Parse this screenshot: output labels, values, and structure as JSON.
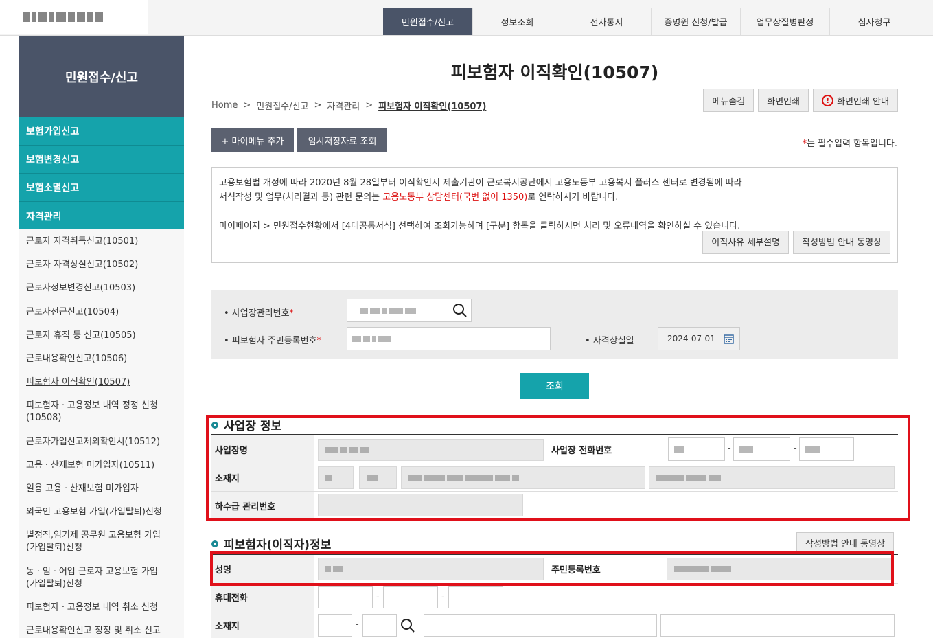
{
  "nav": {
    "items": [
      "민원접수/신고",
      "정보조회",
      "전자통지",
      "증명원 신청/발급",
      "업무상질병판정",
      "심사청구"
    ],
    "active_index": 0
  },
  "sidebar": {
    "title": "민원접수/신고",
    "main_items": [
      "보험가입신고",
      "보험변경신고",
      "보험소멸신고",
      "자격관리"
    ],
    "sub_items": [
      "근로자 자격취득신고(10501)",
      "근로자 자격상실신고(10502)",
      "근로자정보변경신고(10503)",
      "근로자전근신고(10504)",
      "근로자 휴직 등 신고(10505)",
      "근로내용확인신고(10506)",
      "피보험자 이직확인(10507)",
      "피보험자ㆍ고용정보 내역 정정 신청(10508)",
      "근로자가입신고제외확인서(10512)",
      "고용ㆍ산재보험 미가입자(10511)",
      "일용 고용ㆍ산재보험 미가입자",
      "외국인 고용보험 가입(가입탈퇴)신청",
      "별정직,임기제 공무원 고용보험 가입(가입탈퇴)신청",
      "농ㆍ임ㆍ어업 근로자 고용보험 가입(가입탈퇴)신청",
      "피보험자ㆍ고용정보 내역 취소 신청",
      "근로내용확인신고 정정 및 취소 신고"
    ]
  },
  "page": {
    "title": "피보험자 이직확인(10507)",
    "breadcrumb": [
      "Home",
      "민원접수/신고",
      "자격관리",
      "피보험자 이직확인(10507)"
    ],
    "btn_hide_menu": "메뉴숨김",
    "btn_print": "화면인쇄",
    "btn_print_guide": "화면인쇄 안내",
    "btn_add_mymenu": "+ 마이메뉴 추가",
    "btn_temp_saved": "임시저장자료 조회",
    "required_note_star": "*",
    "required_note": "는 필수입력 항목입니다."
  },
  "notice": {
    "line1": "고용보험법 개정에 따라 2020년 8월 28일부터 이직확인서 제출기관이 근로복지공단에서 고용노동부 고용복지 플러스 센터로 변경됨에 따라",
    "line2_pre": "서식작성 및 업무(처리결과 등) 관련 문의는 ",
    "line2_red": "고용노동부 상담센터(국번 없이 1350)",
    "line2_post": "로 연락하시기 바랍니다.",
    "line3": "마이페이지 > 민원접수현황에서 [4대공통서식] 선택하여 조회가능하며 [구분] 항목을 클릭하시면 처리 및 오류내역을 확인하실 수 있습니다.",
    "btn_reason_detail": "이직사유 세부설명",
    "btn_guide_video": "작성방법 안내 동영상"
  },
  "search": {
    "label_workplace_no": "사업장관리번호",
    "label_resident_no": "피보험자 주민등록번호",
    "label_loss_date": "자격상실일",
    "loss_date": "2024-07-01",
    "star": "*",
    "btn_query": "조회"
  },
  "workplace": {
    "title": "사업장 정보",
    "label_name": "사업장명",
    "label_phone": "사업장 전화번호",
    "label_address": "소재지",
    "label_subcontract": "하수급 관리번호"
  },
  "insured": {
    "title": "피보험자(이직자)정보",
    "btn_guide_video": "작성방법 안내 동영상",
    "label_name": "성명",
    "label_resident_no": "주민등록번호",
    "label_mobile": "휴대전화",
    "label_address": "소재지",
    "dash": "-"
  }
}
